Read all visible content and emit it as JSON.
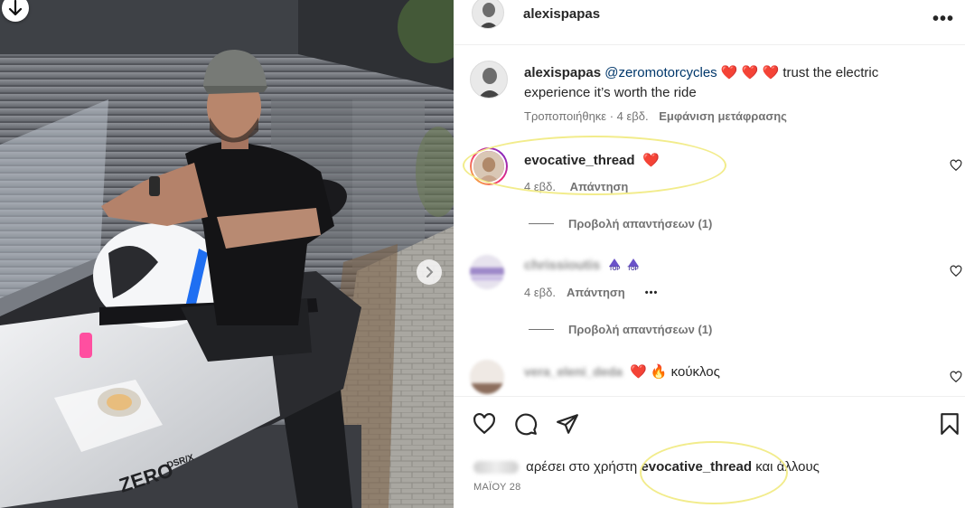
{
  "post": {
    "author": "alexispapas",
    "caption": {
      "author": "alexispapas",
      "mention": "@zeromotorcycles",
      "hearts": "❤️ ❤️ ❤️",
      "text_line1": "trust the electric",
      "text_line2": "experience it’s worth the ride",
      "edited": "Τροποποιήθηκε · 4 εβδ.",
      "translation": "Εμφάνιση μετάφρασης"
    },
    "bike_brand": "ZERO",
    "bike_model": "DSR/X"
  },
  "comments": [
    {
      "author": "evocative_thread",
      "text": "❤️",
      "time": "4 εβδ.",
      "reply": "Απάντηση",
      "view_replies": "Προβολή απαντήσεων (1)"
    },
    {
      "author": "chrissioutis",
      "badges": [
        "TOP",
        "TOP"
      ],
      "time": "4 εβδ.",
      "reply": "Απάντηση",
      "more": "•••",
      "view_replies": "Προβολή απαντήσεων (1)"
    },
    {
      "author": "vera_eleni_deda",
      "text": "❤️ 🔥 κούκλος"
    }
  ],
  "likes": {
    "prefix": "αρέσει στο χρήστη",
    "user": "evocative_thread",
    "suffix": "και άλλους"
  },
  "date": "ΜΑΪΟΥ 28",
  "colors": {
    "highlight": "#f2ec8c",
    "mention": "#00376b",
    "heart": "#ed1d24",
    "secondary_text": "#737373"
  }
}
